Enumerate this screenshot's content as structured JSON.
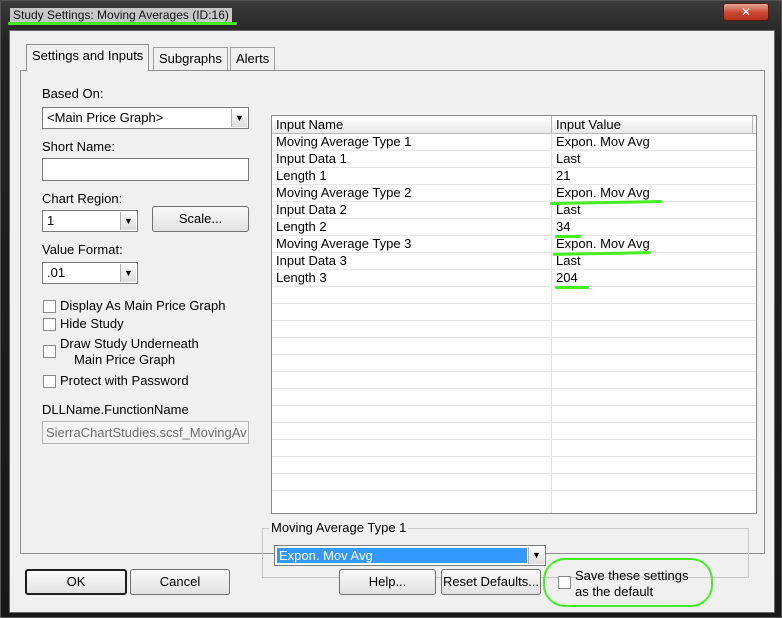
{
  "window": {
    "title": "Study Settings: Moving Averages (ID:16)",
    "close_label": "✕"
  },
  "tabs": [
    {
      "label": "Settings and Inputs",
      "active": true
    },
    {
      "label": "Subgraphs",
      "active": false
    },
    {
      "label": "Alerts",
      "active": false
    }
  ],
  "left": {
    "based_on_label": "Based On:",
    "based_on_value": "<Main Price Graph>",
    "short_name_label": "Short Name:",
    "short_name_value": "",
    "chart_region_label": "Chart Region:",
    "chart_region_value": "1",
    "scale_button": "Scale...",
    "value_format_label": "Value Format:",
    "value_format_value": ".01",
    "checkboxes": [
      {
        "label": "Display As Main Price Graph",
        "checked": false
      },
      {
        "label": "Hide Study",
        "checked": false
      },
      {
        "label": "Draw Study Underneath",
        "label2": "Main Price Graph",
        "checked": false
      },
      {
        "label": "Protect with Password",
        "checked": false
      }
    ],
    "dll_label": "DLLName.FunctionName",
    "dll_value": "SierraChartStudies.scsf_MovingAv"
  },
  "grid": {
    "columns": [
      "Input Name",
      "Input Value"
    ],
    "rows": [
      [
        "Moving Average Type 1",
        "Expon. Mov Avg"
      ],
      [
        "Input Data 1",
        "Last"
      ],
      [
        "Length 1",
        "21"
      ],
      [
        "Moving Average Type 2",
        "Expon. Mov Avg"
      ],
      [
        "Input Data 2",
        "Last"
      ],
      [
        "Length 2",
        "34"
      ],
      [
        "Moving Average Type 3",
        "Expon. Mov Avg"
      ],
      [
        "Input Data 3",
        "Last"
      ],
      [
        "Length 3",
        "204"
      ]
    ]
  },
  "editor": {
    "group_title": "Moving Average Type 1",
    "selected_value": "Expon. Mov Avg"
  },
  "footer": {
    "ok": "OK",
    "cancel": "Cancel",
    "help": "Help...",
    "reset_defaults": "Reset Defaults...",
    "save_default_line1": "Save these settings",
    "save_default_line2": "as the default"
  },
  "colors": {
    "highlight_annotation": "#44ee22",
    "selection": "#3399ff"
  }
}
